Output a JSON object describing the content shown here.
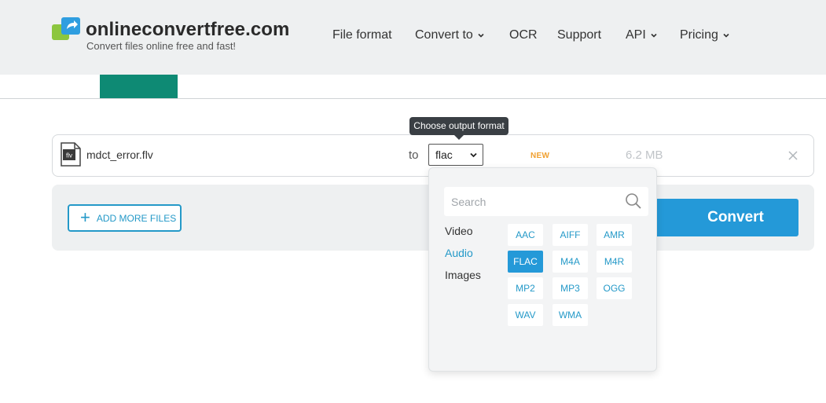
{
  "header": {
    "logo_name": "onlineconvertfree.com",
    "logo_tagline": "Convert files online free and fast!",
    "nav": [
      {
        "label": "File format",
        "dropdown": false
      },
      {
        "label": "Convert to",
        "dropdown": true
      },
      {
        "label": "OCR",
        "dropdown": false
      },
      {
        "label": "Support",
        "dropdown": false
      },
      {
        "label": "API",
        "dropdown": true
      },
      {
        "label": "Pricing",
        "dropdown": true
      }
    ]
  },
  "file": {
    "name": "mdct_error.flv",
    "icon_label": "flv",
    "to_label": "to",
    "format_value": "flac",
    "badge": "NEW",
    "size": "6.2 MB"
  },
  "tooltip": "Choose output format",
  "actions": {
    "add_files": "ADD MORE FILES",
    "convert": "Convert"
  },
  "dropdown": {
    "search_placeholder": "Search",
    "categories": [
      "Video",
      "Audio",
      "Images"
    ],
    "active_category": "Audio",
    "formats": [
      "AAC",
      "AIFF",
      "AMR",
      "FLAC",
      "M4A",
      "M4R",
      "MP2",
      "MP3",
      "OGG",
      "WAV",
      "WMA"
    ],
    "selected_format": "FLAC"
  },
  "colors": {
    "accent": "#2499d8",
    "tab_active": "#0e8a74",
    "badge": "#f0a030",
    "header_bg": "#eef0f1"
  }
}
